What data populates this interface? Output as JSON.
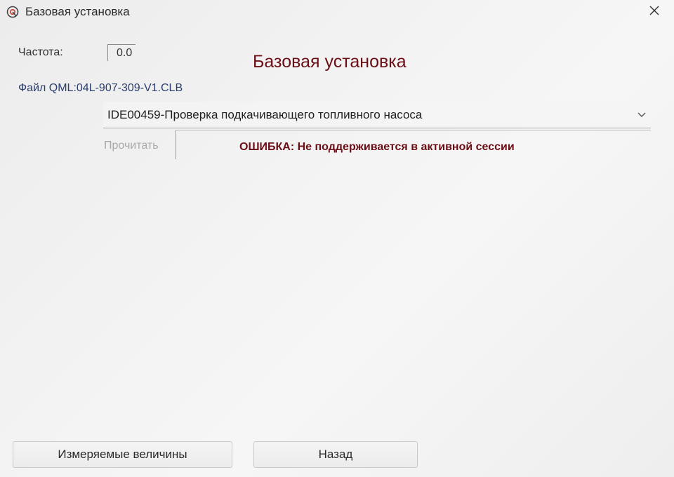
{
  "window": {
    "title": "Базовая установка",
    "icon": "app-logo-icon"
  },
  "frequency": {
    "label": "Частота:",
    "value": "0.0"
  },
  "heading": "Базовая установка",
  "file": {
    "label": "Файл QML:04L-907-309-V1.CLB"
  },
  "procedure_select": {
    "selected": "IDE00459-Проверка подкачивающего топливного насоса"
  },
  "read_button": {
    "label": "Прочитать",
    "enabled": false
  },
  "status": {
    "error_text": "ОШИБКА: Не поддерживается в активной сессии"
  },
  "buttons": {
    "measured_values": "Измеряемые величины",
    "back": "Назад"
  },
  "colors": {
    "heading": "#6b0e16",
    "error": "#6b0e16",
    "file_label": "#2b3d6b",
    "disabled_text": "#a9a9a9"
  }
}
